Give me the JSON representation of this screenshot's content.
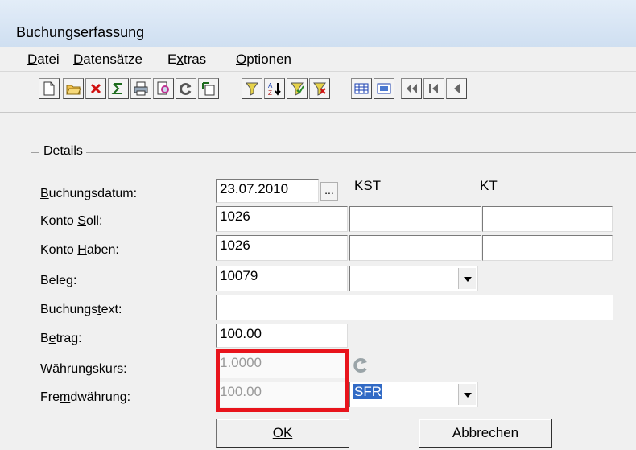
{
  "window": {
    "title": "Buchungserfassung"
  },
  "menu": [
    {
      "label": "Datei"
    },
    {
      "label": "Datensätze"
    },
    {
      "label": "Extras"
    },
    {
      "label": "Optionen"
    }
  ],
  "toolbar": {
    "icons": [
      "new-document-icon",
      "open-folder-icon",
      "delete-icon",
      "sum-icon",
      "print-icon",
      "preview-icon",
      "refresh-icon",
      "export-icon",
      "filter-icon",
      "sort-icon",
      "filter-apply-icon",
      "filter-remove-icon",
      "table-view-icon",
      "form-view-icon",
      "first-record-icon",
      "previous-page-icon",
      "previous-record-icon"
    ]
  },
  "details": {
    "group_label": "Details",
    "col_kst": "KST",
    "col_kt": "KT",
    "labels": {
      "buchungsdatum": "Buchungsdatum:",
      "konto_soll": "Konto Soll:",
      "konto_haben": "Konto Haben:",
      "beleg": "Beleg:",
      "buchungstext": "Buchungstext:",
      "betrag": "Betrag:",
      "waehrungskurs": "Währungskurs:",
      "fremdwaehrung": "Fremdwährung:"
    },
    "values": {
      "buchungsdatum": "23.07.2010",
      "date_picker": "...",
      "konto_soll": "1026",
      "konto_soll_kst": "",
      "konto_soll_kt": "",
      "konto_haben": "1026",
      "konto_haben_kst": "",
      "konto_haben_kt": "",
      "beleg": "10079",
      "beleg_combo": "",
      "buchungstext": "",
      "betrag": "100.00",
      "waehrungskurs": "1.0000",
      "fremdwaehrung": "100.00",
      "currency": "SFR"
    }
  },
  "buttons": {
    "ok": "OK",
    "abbrechen": "Abbrechen"
  },
  "colors": {
    "highlight": "#e8141c",
    "selection": "#316ac5"
  }
}
